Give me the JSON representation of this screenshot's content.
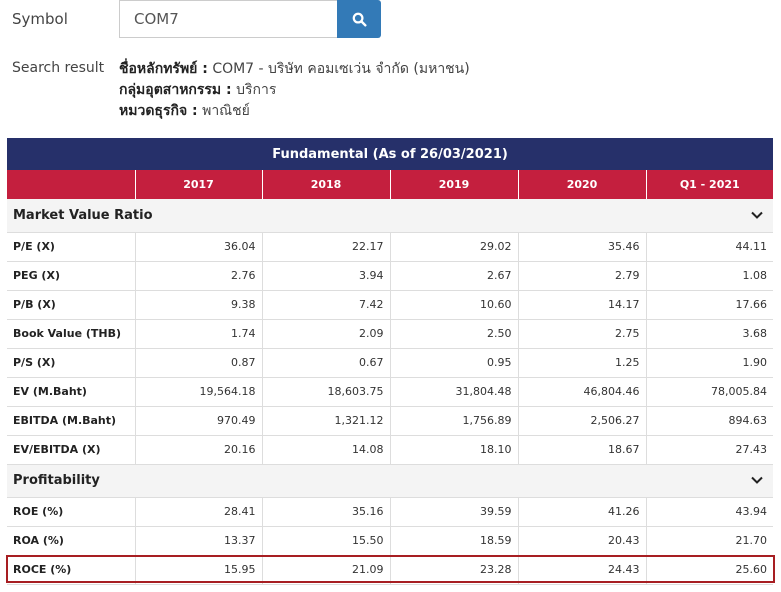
{
  "search": {
    "symbol_label": "Symbol",
    "symbol_value": "COM7",
    "button_icon": "search-icon",
    "result_label": "Search result",
    "security_name_key": "ชื่อหลักทรัพย์ :",
    "security_name_value": "COM7 - บริษัท คอมเซเว่น จำกัด (มหาชน)",
    "industry_key": "กลุ่มอุตสาหกรรม :",
    "industry_value": "บริการ",
    "sector_key": "หมวดธุรกิจ :",
    "sector_value": "พาณิชย์"
  },
  "table": {
    "title": "Fundamental (As of 26/03/2021)",
    "columns": [
      "2017",
      "2018",
      "2019",
      "2020",
      "Q1 - 2021"
    ],
    "sections": [
      {
        "name": "Market Value Ratio",
        "rows": [
          {
            "label": "P/E (X)",
            "values": [
              "36.04",
              "22.17",
              "29.02",
              "35.46",
              "44.11"
            ]
          },
          {
            "label": "PEG (X)",
            "values": [
              "2.76",
              "3.94",
              "2.67",
              "2.79",
              "1.08"
            ]
          },
          {
            "label": "P/B (X)",
            "values": [
              "9.38",
              "7.42",
              "10.60",
              "14.17",
              "17.66"
            ]
          },
          {
            "label": "Book Value (THB)",
            "values": [
              "1.74",
              "2.09",
              "2.50",
              "2.75",
              "3.68"
            ]
          },
          {
            "label": "P/S (X)",
            "values": [
              "0.87",
              "0.67",
              "0.95",
              "1.25",
              "1.90"
            ]
          },
          {
            "label": "EV (M.Baht)",
            "values": [
              "19,564.18",
              "18,603.75",
              "31,804.48",
              "46,804.46",
              "78,005.84"
            ]
          },
          {
            "label": "EBITDA (M.Baht)",
            "values": [
              "970.49",
              "1,321.12",
              "1,756.89",
              "2,506.27",
              "894.63"
            ]
          },
          {
            "label": "EV/EBITDA (X)",
            "values": [
              "20.16",
              "14.08",
              "18.10",
              "18.67",
              "27.43"
            ]
          }
        ]
      },
      {
        "name": "Profitability",
        "rows": [
          {
            "label": "ROE (%)",
            "values": [
              "28.41",
              "35.16",
              "39.59",
              "41.26",
              "43.94"
            ]
          },
          {
            "label": "ROA (%)",
            "values": [
              "13.37",
              "15.50",
              "18.59",
              "20.43",
              "21.70"
            ]
          },
          {
            "label": "ROCE (%)",
            "values": [
              "15.95",
              "21.09",
              "23.28",
              "24.43",
              "25.60"
            ]
          }
        ]
      }
    ]
  },
  "colors": {
    "title_bg": "#26306a",
    "header_bg": "#c41f3e",
    "search_button": "#337ab7",
    "highlight_border": "#a71e22"
  }
}
